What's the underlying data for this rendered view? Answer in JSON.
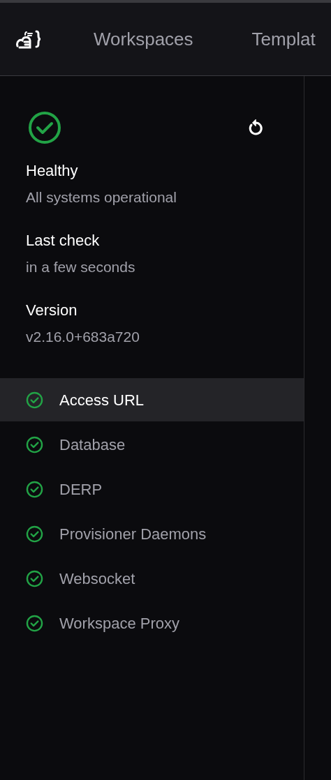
{
  "nav": {
    "items": [
      "Workspaces",
      "Templat"
    ]
  },
  "summary": {
    "healthy": true,
    "fields": [
      {
        "label": "Healthy",
        "value": "All systems operational"
      },
      {
        "label": "Last check",
        "value": "in a few seconds"
      },
      {
        "label": "Version",
        "value": "v2.16.0+683a720"
      }
    ]
  },
  "checks": [
    {
      "label": "Access URL",
      "healthy": true,
      "selected": true
    },
    {
      "label": "Database",
      "healthy": true,
      "selected": false
    },
    {
      "label": "DERP",
      "healthy": true,
      "selected": false
    },
    {
      "label": "Provisioner Daemons",
      "healthy": true,
      "selected": false
    },
    {
      "label": "Websocket",
      "healthy": true,
      "selected": false
    },
    {
      "label": "Workspace Proxy",
      "healthy": true,
      "selected": false
    }
  ]
}
